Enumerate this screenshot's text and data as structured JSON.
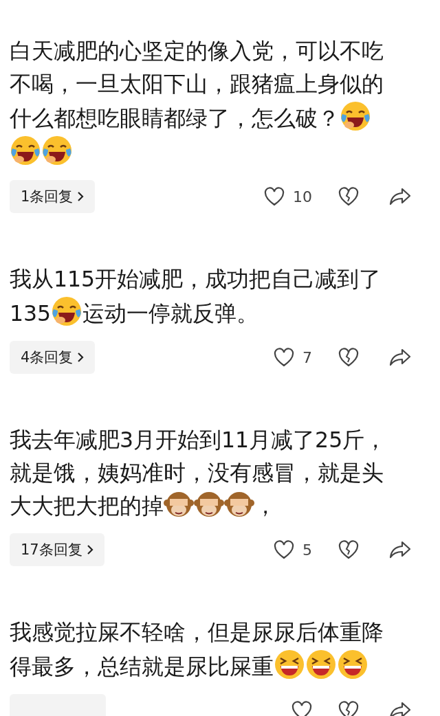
{
  "comments": [
    {
      "parts": [
        {
          "kind": "text",
          "text": "白天减肥的心坚定的像入党，可以不吃不喝，一旦太阳下山，跟猪瘟上身似的什么都想吃眼睛都绿了，怎么破？"
        },
        {
          "kind": "laugh"
        },
        {
          "kind": "laugh"
        },
        {
          "kind": "laugh"
        }
      ],
      "replies": "1条回复",
      "likes": "10"
    },
    {
      "parts": [
        {
          "kind": "text",
          "text": "我从115开始减肥，成功把自己减到了135"
        },
        {
          "kind": "laugh"
        },
        {
          "kind": "text",
          "text": "运动一停就反弹。"
        }
      ],
      "replies": "4条回复",
      "likes": "7"
    },
    {
      "parts": [
        {
          "kind": "text",
          "text": "我去年减肥3月开始到11月减了25斤，就是饿，姨妈准时，没有感冒，就是头大大把大把的掉"
        },
        {
          "kind": "monkey"
        },
        {
          "kind": "monkey"
        },
        {
          "kind": "monkey"
        },
        {
          "kind": "text",
          "text": "，"
        }
      ],
      "replies": "17条回复",
      "likes": "5"
    },
    {
      "parts": [
        {
          "kind": "text",
          "text": "我感觉拉屎不轻啥，但是尿尿后体重降得最多，总结就是尿比屎重"
        },
        {
          "kind": "grin"
        },
        {
          "kind": "grin"
        },
        {
          "kind": "grin"
        }
      ]
    }
  ]
}
